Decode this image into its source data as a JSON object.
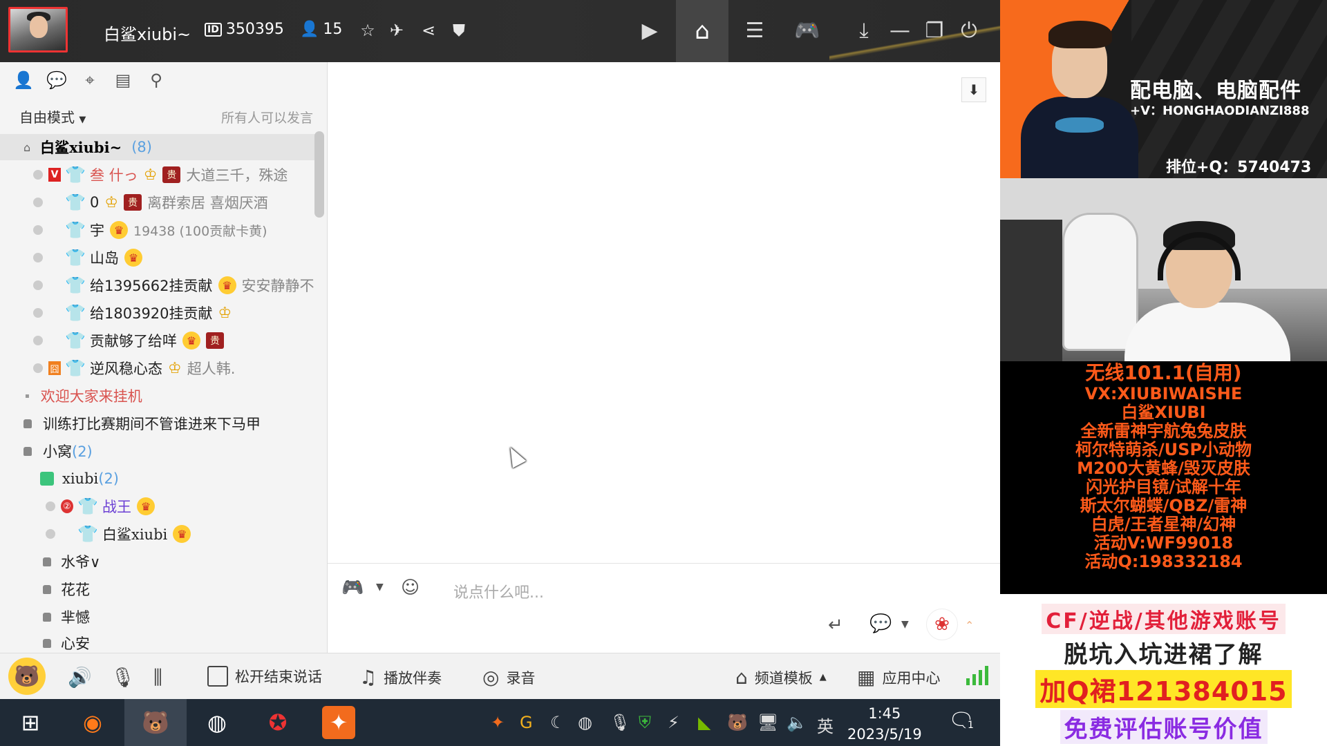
{
  "window": {
    "channel_name": "白鲨xiubi~",
    "channel_id": "350395",
    "online_count": "15"
  },
  "left_panel": {
    "mode": "自由模式",
    "speak_permission": "所有人可以发言",
    "root": {
      "name": "白鲨xiubi~",
      "count": "(8)"
    },
    "members": [
      {
        "name": "叁 什っ",
        "signature": "大道三千，殊途",
        "color": "red"
      },
      {
        "name": "0",
        "signature": "离群索居  喜烟厌酒",
        "color": "normal"
      },
      {
        "name": "宇",
        "signature": "19438 (100贡献卡黄)",
        "color": "normal"
      },
      {
        "name": "山岛",
        "signature": "",
        "color": "normal"
      },
      {
        "name": "给1395662挂贡献",
        "signature": "安安静静不",
        "color": "normal"
      },
      {
        "name": "给1803920挂贡献",
        "signature": "",
        "color": "normal"
      },
      {
        "name": "贡献够了给咩",
        "signature": "",
        "color": "normal"
      },
      {
        "name": "逆风稳心态",
        "signature": "超人韩.",
        "color": "normal"
      }
    ],
    "channels": [
      {
        "name": "欢迎大家来挂机"
      },
      {
        "name": "训练打比赛期间不管谁进来下马甲"
      },
      {
        "name": "小窝",
        "count": "(2)"
      }
    ],
    "subchannel": {
      "name": "xiubi",
      "count": "(2)"
    },
    "sub_members": [
      {
        "name": "战王"
      },
      {
        "name": "白鲨xiubi"
      }
    ],
    "more_channels": [
      "水爷∨",
      "花花",
      "芈憾",
      "心安"
    ]
  },
  "chat": {
    "input_placeholder": "说点什么吧..."
  },
  "bottom_bar": {
    "release_to_end": "松开结束说话",
    "accompaniment": "播放伴奏",
    "record": "录音",
    "channel_template": "频道模板",
    "app_center": "应用中心"
  },
  "taskbar": {
    "ime": "英",
    "time": "1:45",
    "date": "2023/5/19",
    "notifications": "1"
  },
  "overlay": {
    "ad_top_line1": "配电脑、电脑配件",
    "ad_top_line2": "+V：HONGHAODIANZI888",
    "ad_top_line3": "排位+Q：5740473",
    "ad_mid_lines": [
      "无线101.1(自用)",
      "VX:XIUBIWAISHE",
      "白鲨XIUBI",
      "全新雷神宇航兔兔皮肤",
      "柯尔特萌杀/USP小动物",
      "M200大黄蜂/毁灭皮肤",
      "闪光护目镜/试解十年",
      "斯太尔蝴蝶/QBZ/雷神",
      "白虎/王者星神/幻神",
      "活动V:WF99018",
      "活动Q:198332184"
    ],
    "ad_bot_line1": "CF/逆战/其他游戏账号",
    "ad_bot_line2": "脱坑入坑进裙了解",
    "ad_bot_line3": "加Q裙121384015",
    "ad_bot_line4": "免费评估账号价值"
  }
}
